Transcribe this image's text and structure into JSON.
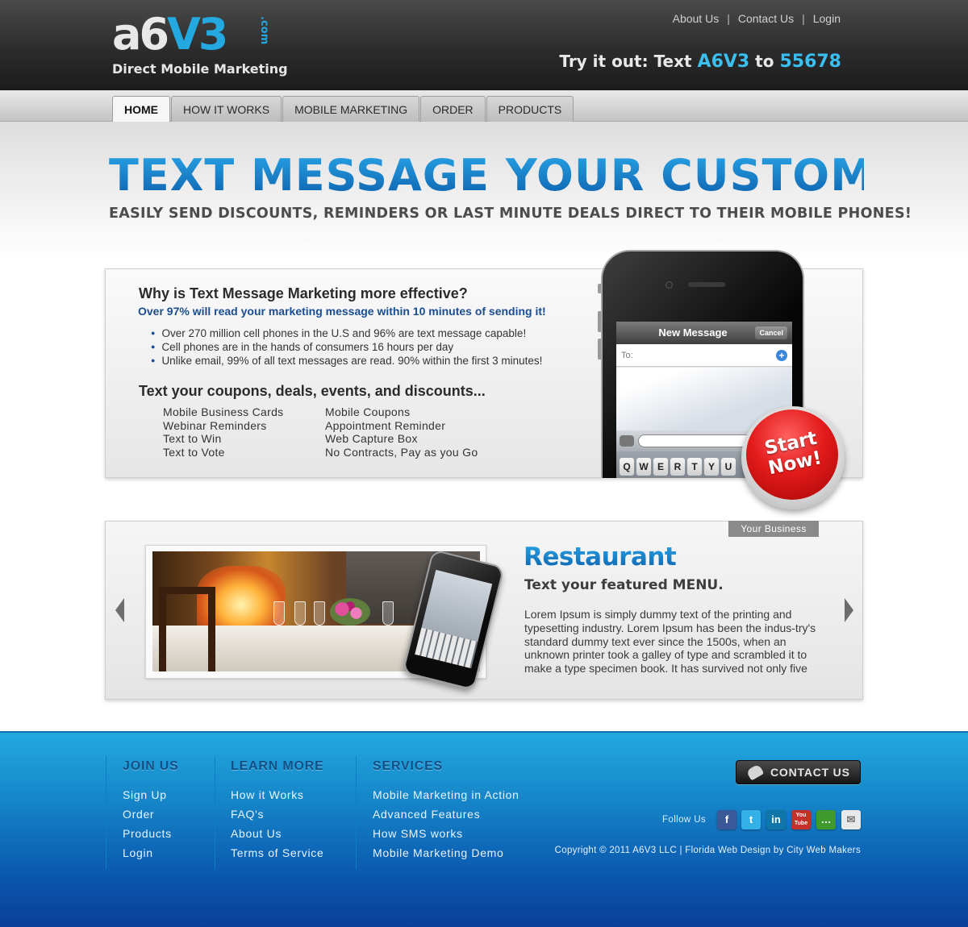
{
  "header": {
    "logo_text_a": "a6",
    "logo_text_b": "V3",
    "logo_suffix": ".com",
    "logo_tagline": "Direct Mobile Marketing",
    "top_links": [
      "About Us",
      "Contact Us",
      "Login"
    ],
    "try_prefix": "Try it out: Text ",
    "try_code": "A6V3",
    "try_mid": " to ",
    "try_number": "55678"
  },
  "nav": {
    "tabs": [
      "HOME",
      "HOW IT WORKS",
      "MOBILE MARKETING",
      "ORDER",
      "PRODUCTS"
    ],
    "active": "HOME"
  },
  "hero": {
    "title": "TEXT MESSAGE YOUR CUSTOMERS!",
    "subtitle": "EASILY SEND DISCOUNTS, REMINDERS OR LAST MINUTE DEALS DIRECT TO THEIR MOBILE PHONES!"
  },
  "info": {
    "why_title": "Why is Text Message Marketing more effective?",
    "why_sub": "Over 97%  will read your marketing message within 10 minutes of sending it!",
    "bullets": [
      "Over 270 million cell phones in the U.S and 96% are text message capable!",
      "Cell phones are in the hands of consumers 16 hours per day",
      "Unlike email, 99% of all text messages are read.  90% within the first 3 minutes!"
    ],
    "coupons_title": "Text your coupons, deals, events, and discounts...",
    "features_col1": [
      "Mobile Business Cards",
      "Webinar Reminders",
      "Text to Win",
      "Text to Vote"
    ],
    "features_col2": [
      "Mobile Coupons",
      "Appointment Reminder",
      "Web Capture Box",
      "No Contracts, Pay as you Go"
    ]
  },
  "phone": {
    "screen_title": "New Message",
    "cancel_label": "Cancel",
    "to_label": "To:",
    "plus": "+",
    "keys": [
      "Q",
      "W",
      "E",
      "R",
      "T",
      "Y",
      "U"
    ]
  },
  "start_button": {
    "line1": "Start",
    "line2": "Now!"
  },
  "carousel": {
    "tag": "Your Business",
    "title": "Restaurant",
    "subtitle": "Text your featured MENU.",
    "body": "Lorem Ipsum is simply dummy text of the printing and typesetting industry. Lorem Ipsum has been the indus-try's standard dummy text ever since the 1500s, when an unknown printer took a galley of type and scrambled it to make a type specimen book. It has survived not only five"
  },
  "footer": {
    "join_title": "JOIN US",
    "join_links": [
      "Sign Up",
      "Order",
      "Products",
      "Login"
    ],
    "learn_title": "LEARN MORE",
    "learn_links": [
      "How it Works",
      "FAQ's",
      "About Us",
      "Terms of Service"
    ],
    "services_title": "SERVICES",
    "services_links": [
      "Mobile Marketing in Action",
      "Advanced Features",
      "How SMS works",
      "Mobile Marketing Demo"
    ],
    "contact_label": "CONTACT US",
    "follow_label": "Follow Us",
    "social": [
      {
        "icon": "facebook-icon",
        "glyph": "f",
        "color": "#3b5998"
      },
      {
        "icon": "twitter-icon",
        "glyph": "t",
        "color": "#33b1e6"
      },
      {
        "icon": "linkedin-icon",
        "glyph": "in",
        "color": "#0e76a8"
      },
      {
        "icon": "youtube-icon",
        "glyph": "You Tube",
        "color": "#c4302b"
      },
      {
        "icon": "chat-icon",
        "glyph": "…",
        "color": "#3f9a2e"
      },
      {
        "icon": "email-icon",
        "glyph": "✉",
        "color": "#e9e9e9"
      }
    ],
    "copyright": "Copyright © 2011 A6V3 LLC | Florida Web Design by City Web Makers"
  },
  "colors": {
    "brand_blue": "#1577c0",
    "accent_cyan": "#3bbef0",
    "start_red": "#e31b1b",
    "footer_blue": "#1585c8"
  }
}
